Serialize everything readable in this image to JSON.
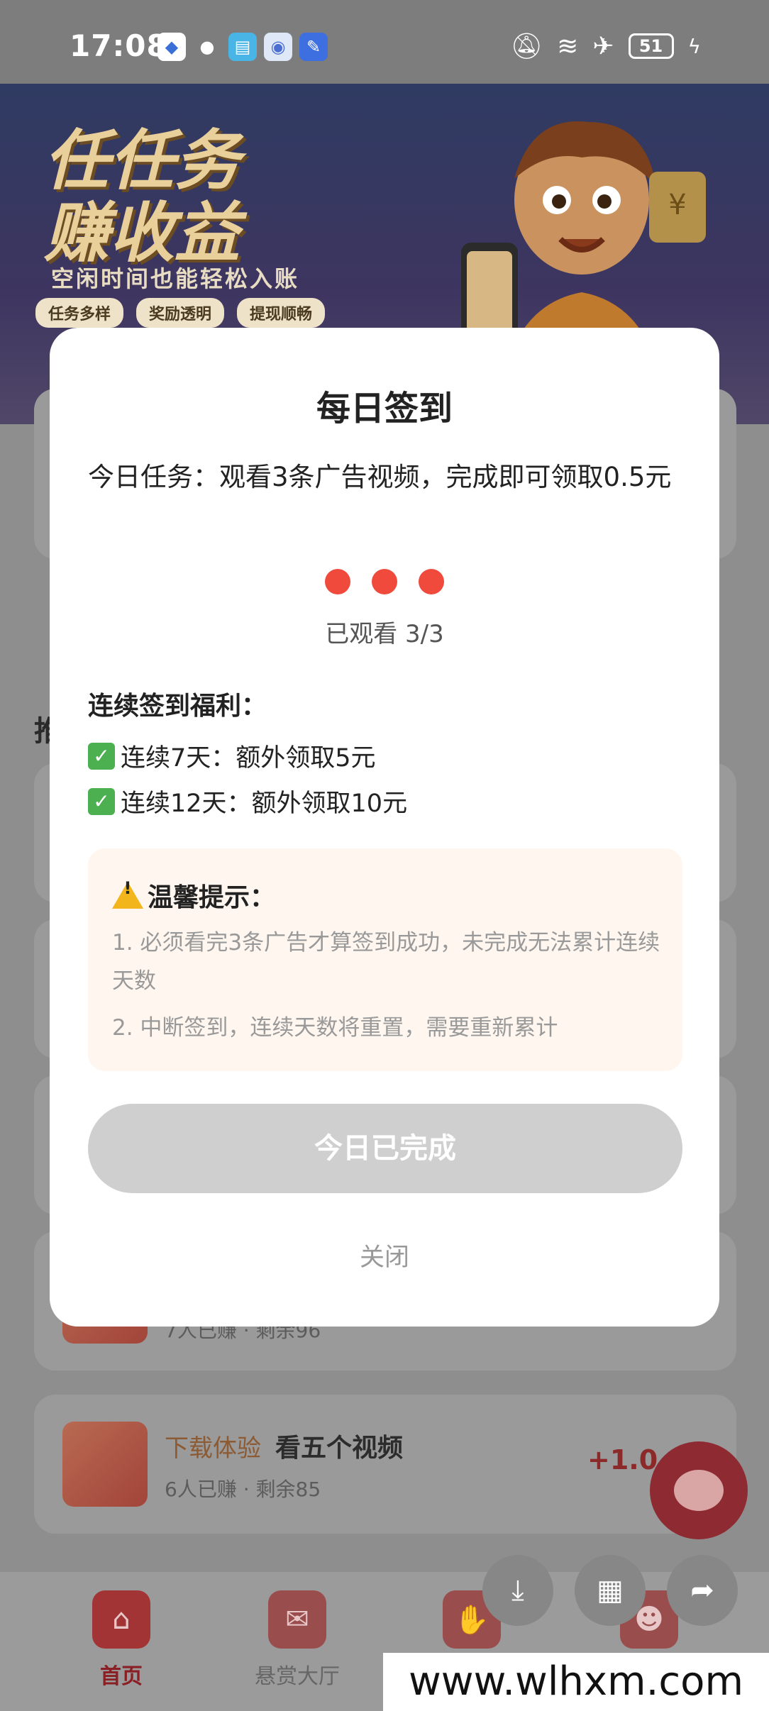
{
  "status_bar": {
    "time": "17:08",
    "battery": "51",
    "icons": [
      "shield-icon",
      "qq-penguin-icon",
      "book-icon",
      "bird-icon",
      "edit-icon",
      "bell-muted-icon",
      "wifi-icon",
      "airplane-icon",
      "battery-icon",
      "charging-icon"
    ]
  },
  "banner": {
    "headline_1": "任任务",
    "headline_2": "赚收益",
    "subtitle": "空闲时间也能轻松入账",
    "tags": [
      "任务多样",
      "奖励透明",
      "提现顺畅"
    ]
  },
  "background_list": {
    "partial_heading": "推",
    "tasks": [
      {
        "tag": "",
        "title": "",
        "meta": "7人已赚 · 剩余96",
        "reward": ""
      },
      {
        "tag": "下载体验",
        "title": "看五个视频",
        "meta": "6人已赚 · 剩余85",
        "reward": "+1.0"
      }
    ]
  },
  "dialog": {
    "title": "每日签到",
    "task_text": "今日任务：观看3条广告视频，完成即可领取0.5元",
    "progress": {
      "watched": 3,
      "total": 3,
      "label": "已观看 3/3"
    },
    "bonus_title": "连续签到福利：",
    "bonuses": [
      "连续7天：额外领取5元",
      "连续12天：额外领取10元"
    ],
    "tips_title": "温馨提示：",
    "tips": [
      "1. 必须看完3条广告才算签到成功，未完成无法累计连续天数",
      "2. 中断签到，连续天数将重置，需要重新累计"
    ],
    "done_button": "今日已完成",
    "close_label": "关闭"
  },
  "bottom_nav": {
    "items": [
      {
        "label": "首页",
        "icon": "home-icon",
        "active": true
      },
      {
        "label": "悬赏大厅",
        "icon": "mail-icon",
        "active": false
      },
      {
        "label": "",
        "icon": "handshake-icon",
        "active": false
      },
      {
        "label": "",
        "icon": "profile-icon",
        "active": false
      }
    ]
  },
  "floating_actions": [
    "download-icon",
    "grid-icon",
    "share-icon"
  ],
  "watermark": "www.wlhxm.com",
  "colors": {
    "accent_red": "#f04a3c",
    "done_button_gray": "#cfcfcf",
    "tips_background": "#fff6ef"
  }
}
